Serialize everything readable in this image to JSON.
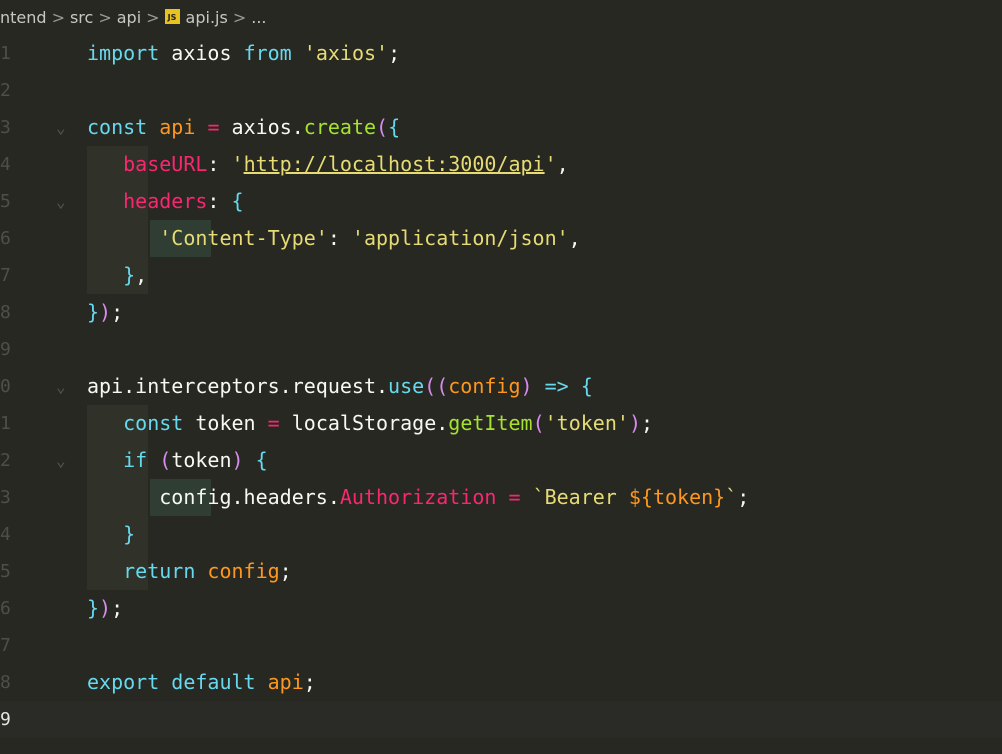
{
  "breadcrumb": {
    "items": [
      "ntend",
      "src",
      "api",
      "api.js",
      "..."
    ],
    "separator": ">",
    "file_icon_label": "JS"
  },
  "code": {
    "lines": [
      {
        "number": "1",
        "text": "import axios from 'axios';"
      },
      {
        "number": "2",
        "text": ""
      },
      {
        "number": "3",
        "text": "const api = axios.create({"
      },
      {
        "number": "4",
        "text": "    baseURL: 'http://localhost:3000/api',"
      },
      {
        "number": "5",
        "text": "    headers: {"
      },
      {
        "number": "6",
        "text": "        'Content-Type': 'application/json',"
      },
      {
        "number": "7",
        "text": "    },"
      },
      {
        "number": "8",
        "text": "});"
      },
      {
        "number": "9",
        "text": ""
      },
      {
        "number": "0",
        "text": "api.interceptors.request.use((config) => {"
      },
      {
        "number": "1",
        "text": "    const token = localStorage.getItem('token');"
      },
      {
        "number": "2",
        "text": "    if (token) {"
      },
      {
        "number": "3",
        "text": "        config.headers.Authorization = `Bearer ${token}`;"
      },
      {
        "number": "4",
        "text": "    }"
      },
      {
        "number": "5",
        "text": "    return config;"
      },
      {
        "number": "6",
        "text": "});"
      },
      {
        "number": "7",
        "text": ""
      },
      {
        "number": "8",
        "text": "export default api;"
      },
      {
        "number": "9",
        "text": ""
      }
    ],
    "active_line_index": 18
  },
  "theme": {
    "background": "#272822",
    "keyword": "#66d9ef",
    "string": "#e6db74",
    "variable": "#fd971f",
    "function": "#a6e22e",
    "operator": "#f92672"
  }
}
